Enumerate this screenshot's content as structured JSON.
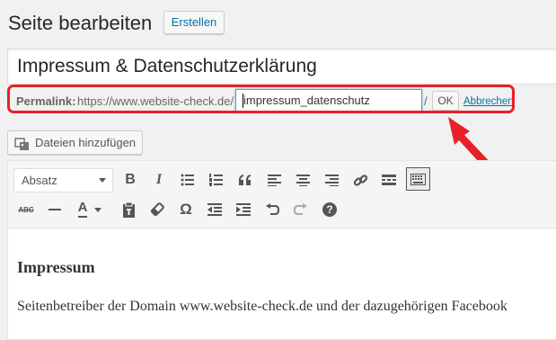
{
  "header": {
    "title": "Seite bearbeiten",
    "new_button": "Erstellen"
  },
  "title_field": {
    "value": "Impressum & Datenschutzerklärung"
  },
  "permalink": {
    "label": "Permalink:",
    "base_url": "https://www.website-check.de/",
    "slug": "impressum_datenschutz",
    "trailing": "/",
    "ok_label": "OK",
    "cancel_label": "Abbrechen"
  },
  "media_button": {
    "label": "Dateien hinzufügen",
    "icon": "media-icon"
  },
  "toolbar": {
    "format_select": "Absatz",
    "row1_icons": [
      "bold-icon",
      "italic-icon",
      "bulleted-list-icon",
      "numbered-list-icon",
      "blockquote-icon",
      "align-left-icon",
      "align-center-icon",
      "align-right-icon",
      "link-icon",
      "read-more-icon",
      "toolbar-toggle-icon"
    ],
    "row2_icons": [
      "strikethrough-icon",
      "horizontal-line-icon",
      "text-color-icon",
      "paste-as-text-icon",
      "clear-formatting-icon",
      "special-character-icon",
      "outdent-icon",
      "indent-icon",
      "undo-icon",
      "redo-icon",
      "help-icon"
    ],
    "bold": "B",
    "italic": "I",
    "text_color": "A",
    "omega": "Ω",
    "strike": "ABC",
    "help": "?"
  },
  "content": {
    "heading": "Impressum",
    "paragraph": "Seitenbetreiber der Domain www.website-check.de und der dazugehörigen Facebook"
  },
  "colors": {
    "highlight": "#e8202a",
    "link": "#0073aa"
  }
}
